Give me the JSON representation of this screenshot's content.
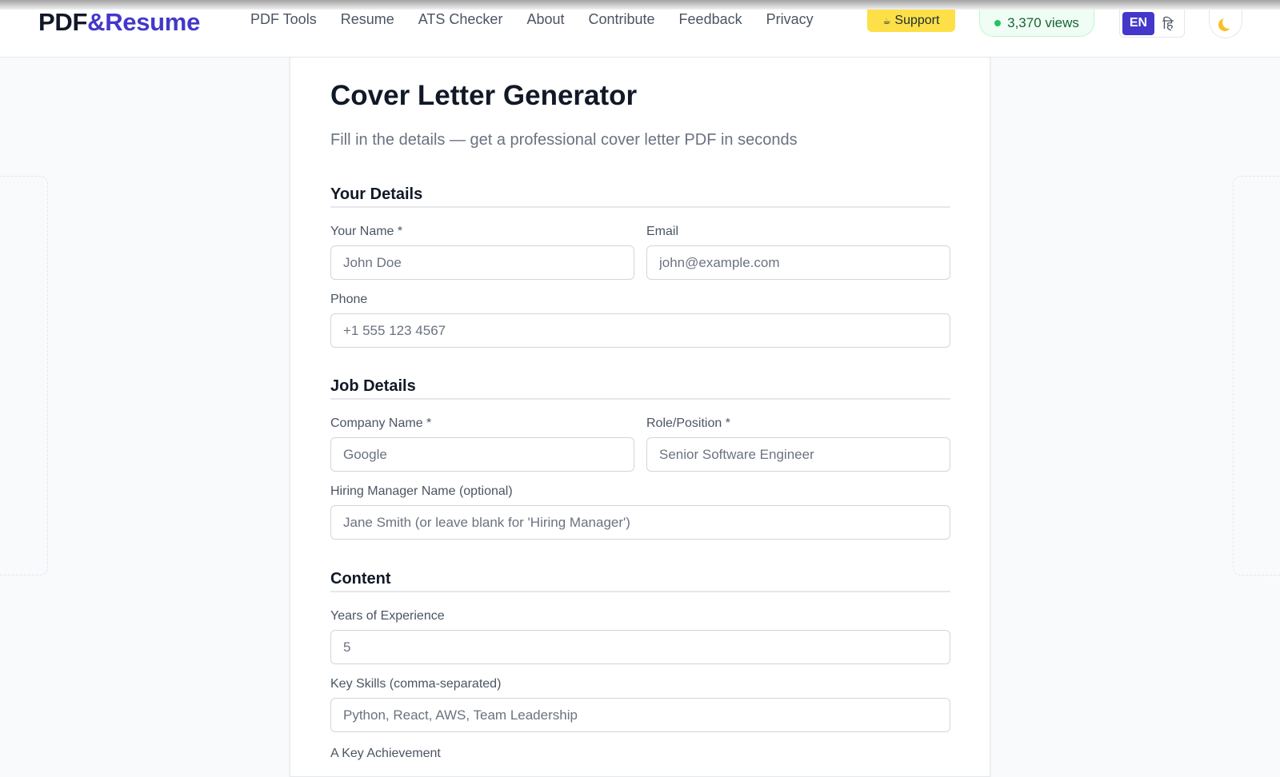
{
  "header": {
    "logo_part1": "PDF",
    "logo_part2": "&Resume",
    "nav": [
      "PDF Tools",
      "Resume",
      "ATS Checker",
      "About",
      "Contribute",
      "Feedback",
      "Privacy"
    ],
    "support_label": "Support",
    "support_icon": "coffee-icon",
    "views_label": "3,370  views",
    "lang_en": "EN",
    "lang_hi": "हि",
    "theme_icon": "moon-icon"
  },
  "page": {
    "title": "Cover Letter Generator",
    "subtitle": "Fill in the details — get a professional cover letter PDF in seconds"
  },
  "sections": {
    "your_details": "Your Details",
    "job_details": "Job Details",
    "content": "Content"
  },
  "fields": {
    "name": {
      "label": "Your Name *",
      "placeholder": "John Doe"
    },
    "email": {
      "label": "Email",
      "placeholder": "john@example.com"
    },
    "phone": {
      "label": "Phone",
      "placeholder": "+1 555 123 4567"
    },
    "company": {
      "label": "Company Name *",
      "placeholder": "Google"
    },
    "role": {
      "label": "Role/Position *",
      "placeholder": "Senior Software Engineer"
    },
    "manager": {
      "label": "Hiring Manager Name (optional)",
      "placeholder": "Jane Smith (or leave blank for 'Hiring Manager')"
    },
    "years": {
      "label": "Years of Experience",
      "placeholder": "5"
    },
    "skills": {
      "label": "Key Skills (comma-separated)",
      "placeholder": "Python, React, AWS, Team Leadership"
    },
    "achievement": {
      "label": "A Key Achievement"
    }
  },
  "colors": {
    "brand": "#4338ca",
    "support": "#fde047",
    "views_bg": "#f0fdf4",
    "views_dot": "#22c55e"
  }
}
